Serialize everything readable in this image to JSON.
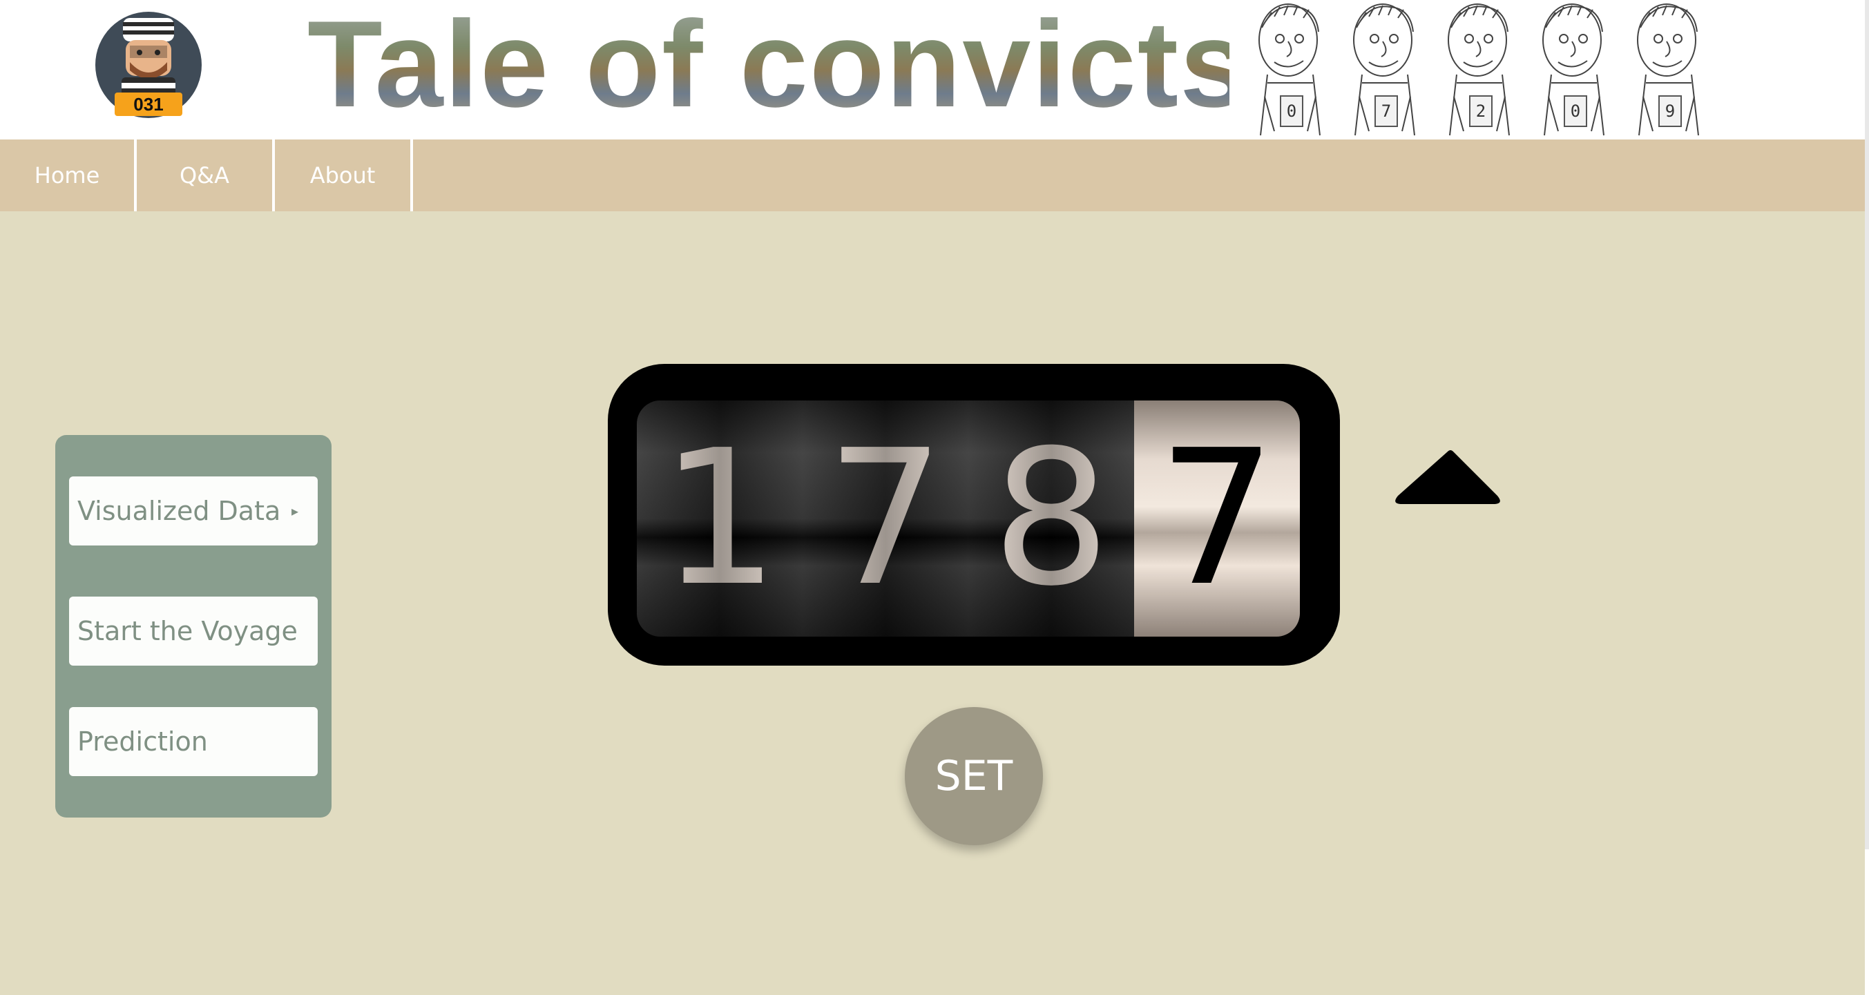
{
  "header": {
    "title": "Tale of convicts",
    "logo_badge": "031",
    "convict_tags": [
      "0",
      "7",
      "2",
      "0",
      "9"
    ]
  },
  "nav": {
    "items": [
      {
        "label": "Home"
      },
      {
        "label": "Q&A"
      },
      {
        "label": "About"
      }
    ]
  },
  "sidebar": {
    "items": [
      {
        "label": "Visualized Data",
        "arrow_icon": "triangle-right-icon"
      },
      {
        "label": "Start the Voyage"
      },
      {
        "label": "Prediction"
      }
    ]
  },
  "counter": {
    "digits": [
      "1",
      "7",
      "8",
      "7"
    ],
    "highlighted_index": 3,
    "value": 1787
  },
  "controls": {
    "increment_icon": "triangle-up-icon",
    "set_label": "SET"
  },
  "colors": {
    "page_background": "#e1dcc1",
    "navbar": "#dac7a7",
    "sidebar": "#899e8e",
    "set_button": "#9e9986",
    "counter_frame": "#000000"
  }
}
